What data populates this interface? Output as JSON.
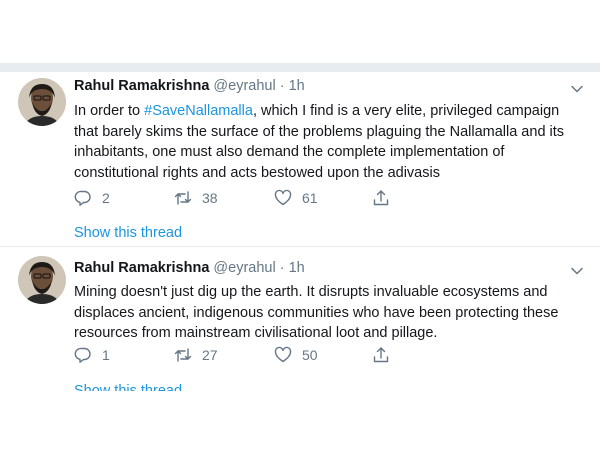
{
  "colors": {
    "accent": "#1b95e0",
    "secondary_text": "#657786",
    "divider": "#e6ecf0"
  },
  "tweets": [
    {
      "author_name": "Rahul Ramakrishna",
      "handle": "@eyrahul",
      "time": "· 1h",
      "text_before": "In order to ",
      "hashtag": "#SaveNallamalla",
      "text_after": ", which I find is a very elite, privileged campaign that barely skims the surface of the problems plaguing the Nallamalla and its inhabitants, one must also demand the complete implementation of constitutional rights and acts bestowed upon the adivasis",
      "replies": "2",
      "retweets": "38",
      "likes": "61",
      "show_thread": "Show this thread"
    },
    {
      "author_name": "Rahul Ramakrishna",
      "handle": "@eyrahul",
      "time": "· 1h",
      "text": "Mining doesn't just dig up the earth. It disrupts invaluable ecosystems and displaces ancient, indigenous communities who have been protecting these resources from mainstream civilisational loot and pillage.",
      "replies": "1",
      "retweets": "27",
      "likes": "50",
      "show_thread": "Show this thread"
    }
  ]
}
